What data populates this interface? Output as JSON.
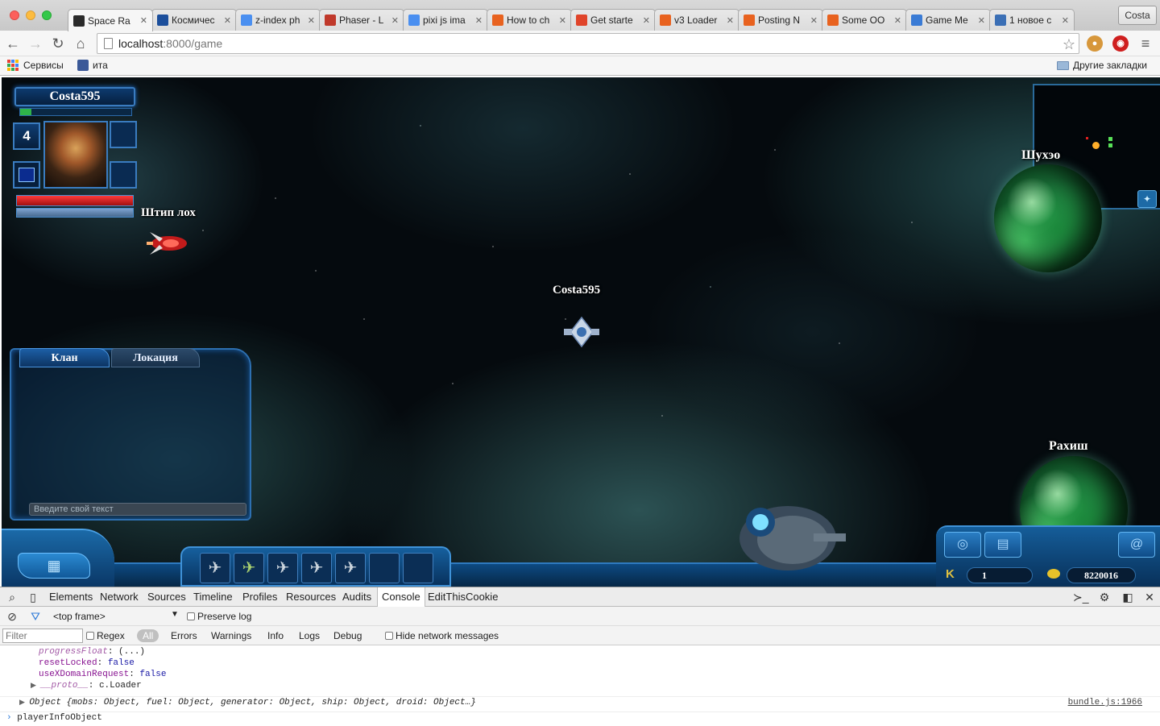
{
  "browser": {
    "tabs": [
      {
        "title": "Space Ra",
        "icon_color": "#2a2a2a",
        "active": true
      },
      {
        "title": "Космичес",
        "icon_color": "#1b4e9b"
      },
      {
        "title": "z-index ph",
        "icon_color": "#4a8ff0"
      },
      {
        "title": "Phaser - L",
        "icon_color": "#c0392b"
      },
      {
        "title": "pixi js ima",
        "icon_color": "#4a8ff0"
      },
      {
        "title": "How to ch",
        "icon_color": "#e8621f"
      },
      {
        "title": "Get starte",
        "icon_color": "#e0442a"
      },
      {
        "title": "v3 Loader",
        "icon_color": "#e8621f"
      },
      {
        "title": "Posting N",
        "icon_color": "#e8621f"
      },
      {
        "title": "Some OO",
        "icon_color": "#e8621f"
      },
      {
        "title": "Game Me",
        "icon_color": "#3a7bd5"
      },
      {
        "title": "1 новое с",
        "icon_color": "#3b6fb5"
      }
    ],
    "tab_close_glyph": "✕",
    "profile_name": "Costa",
    "url_host": "localhost",
    "url_path": ":8000/game",
    "bookmarks": {
      "apps_label": "Сервисы",
      "item_label": "ита",
      "other_label": "Другие закладки"
    }
  },
  "game": {
    "player": {
      "name": "Costa595",
      "level": "4",
      "xp_fraction": 0.1,
      "hp_fraction": 1.0,
      "shield_fraction": 1.0
    },
    "labels": {
      "enemy_name": "Штип лох",
      "ship_name": "Costa595",
      "planet_top": "Шухэо",
      "planet_bottom": "Рахиш"
    },
    "chat": {
      "tab_clan": "Клан",
      "tab_location": "Локация",
      "input_placeholder": "Введите свой текст"
    },
    "hud": {
      "counter_left": "1",
      "counter_right": "8220016"
    }
  },
  "devtools": {
    "tabs": [
      "Elements",
      "Network",
      "Sources",
      "Timeline",
      "Profiles",
      "Resources",
      "Audits",
      "Console",
      "EditThisCookie"
    ],
    "active_tab": "Console",
    "frame": "<top frame>",
    "preserve_log": "Preserve log",
    "filter_placeholder": "Filter",
    "regex": "Regex",
    "levels": [
      "All",
      "Errors",
      "Warnings",
      "Info",
      "Logs",
      "Debug"
    ],
    "hide_network": "Hide network messages",
    "lines": {
      "l1_key": "progressFloat",
      "l1_val": "(...)",
      "l2_key": "resetLocked",
      "l2_val": "false",
      "l3_key": "useXDomainRequest",
      "l3_val": "false",
      "l4_key": "__proto__",
      "l4_val": "c.Loader",
      "object_summary": "Object {mobs: Object, fuel: Object, generator: Object, ship: Object, droid: Object…}",
      "source": "bundle.js:1966",
      "command": "playerInfoObject"
    }
  }
}
